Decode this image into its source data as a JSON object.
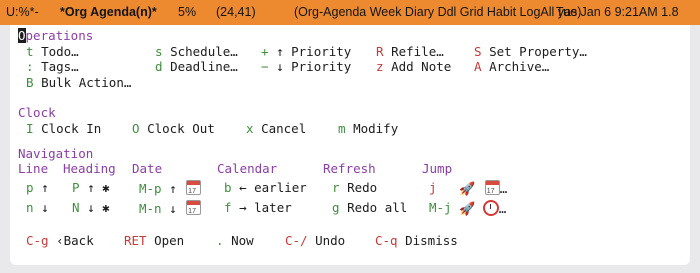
{
  "modeline": {
    "state": "U:%*-",
    "buffer": "*Org Agenda(n)*",
    "percent": "5%",
    "position": "(24,41)",
    "modes": "(Org-Agenda Week Diary Ddl Grid Habit LogAll yas)",
    "datetime": "Tue Jan  6 9:21AM 1.8"
  },
  "operations": {
    "heading_first": "O",
    "heading_rest": "perations",
    "r1": [
      {
        "key": "t",
        "label": "Todo…"
      },
      {
        "key": "s",
        "label": "Schedule…"
      },
      {
        "key": "+",
        "label": "↑ Priority"
      },
      {
        "key": "R",
        "label": "Refile…"
      },
      {
        "key": "S",
        "label": "Set Property…"
      }
    ],
    "r2": [
      {
        "key": ":",
        "label": "Tags…"
      },
      {
        "key": "d",
        "label": "Deadline…"
      },
      {
        "key": "−",
        "label": "↓ Priority"
      },
      {
        "key": "z",
        "label": "Add Note"
      },
      {
        "key": "A",
        "label": "Archive…"
      }
    ],
    "r3": [
      {
        "key": "B",
        "label": "Bulk Action…"
      }
    ]
  },
  "clock": {
    "heading": "Clock",
    "items": [
      {
        "key": "I",
        "label": "Clock In"
      },
      {
        "key": "O",
        "label": "Clock Out"
      },
      {
        "key": "x",
        "label": "Cancel"
      },
      {
        "key": "m",
        "label": "Modify"
      }
    ]
  },
  "navigation": {
    "heading": "Navigation",
    "columns": [
      "Line",
      "Heading",
      "Date",
      "Calendar",
      "Refresh",
      "Jump"
    ],
    "r1": {
      "line_key": "p",
      "line_arrow": "↑",
      "heading_key": "P",
      "heading_arrow": "↑ ✱",
      "date_key": "M-p",
      "date_arrow": "↑",
      "calendar_key": "b",
      "calendar_label": "← earlier",
      "refresh_key": "r",
      "refresh_label": "Redo",
      "jump_key": "j",
      "jump_icons_tail": "…"
    },
    "r2": {
      "line_key": "n",
      "line_arrow": "↓",
      "heading_key": "N",
      "heading_arrow": "↓ ✱",
      "date_key": "M-n",
      "date_arrow": "↓",
      "calendar_key": "f",
      "calendar_label": "→ later",
      "refresh_key": "g",
      "refresh_label": "Redo all",
      "jump_key": "M-j",
      "jump_icons_tail": "…"
    }
  },
  "footer": [
    {
      "key": "C-g",
      "label": "‹Back"
    },
    {
      "key": "RET",
      "label": "Open"
    },
    {
      "key": ".",
      "label": "Now"
    },
    {
      "key": "C-/",
      "label": "Undo"
    },
    {
      "key": "C-q",
      "label": "Dismiss"
    }
  ]
}
